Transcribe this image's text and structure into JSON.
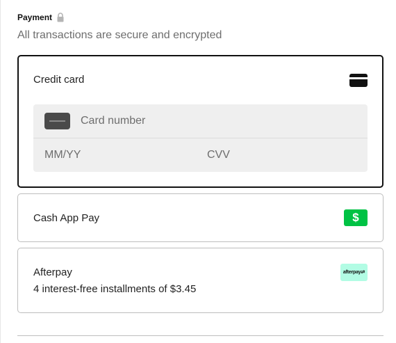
{
  "payment": {
    "heading": "Payment",
    "subtitle": "All transactions are secure and encrypted"
  },
  "options": {
    "credit_card": {
      "label": "Credit card",
      "icon": "credit-card-icon",
      "card_number_placeholder": "Card number",
      "expiry_placeholder": "MM/YY",
      "cvv_placeholder": "CVV"
    },
    "cash_app": {
      "label": "Cash App Pay",
      "icon_glyph": "$",
      "icon_color": "#00c244"
    },
    "afterpay": {
      "label": "Afterpay",
      "description": "4 interest-free installments of $3.45",
      "badge_color": "#b2fce4"
    }
  },
  "colors": {
    "selected_border": "#111111",
    "option_border": "#bdbdbd",
    "field_background": "#efefef"
  }
}
